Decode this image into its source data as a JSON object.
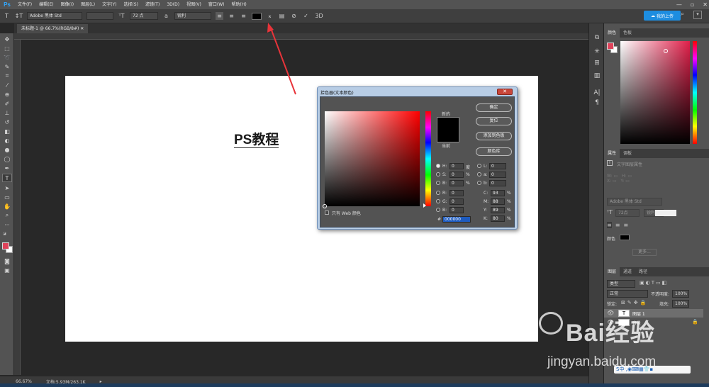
{
  "app": {
    "logo": "Ps"
  },
  "menu": [
    "文件(F)",
    "编辑(E)",
    "图像(I)",
    "图层(L)",
    "文字(Y)",
    "选择(S)",
    "滤镜(T)",
    "3D(D)",
    "视图(V)",
    "窗口(W)",
    "帮助(H)"
  ],
  "window_controls": [
    "—",
    "▫",
    "✕"
  ],
  "options": {
    "font_family": "Adobe 黑体 Std",
    "font_size": "72 点",
    "aa_label": "a",
    "aa_mode": "锐利",
    "text_color": "#000000",
    "cloud_button": "我的上传"
  },
  "document_tab": "未标题-1 @ 66.7%(RGB/8#) ✕",
  "canvas_text": "PS教程",
  "status": {
    "zoom": "66.67%",
    "doc_info": "文档:5.93M/263.1K"
  },
  "right_panels": {
    "color_tabs": [
      "颜色",
      "色板"
    ],
    "props_tabs": [
      "属性",
      "调板"
    ],
    "props_header": "文字图层属性",
    "props_font": "Adobe 黑体 Std",
    "props_size": "72点",
    "props_aa": "锐利",
    "props_color_label": "颜色",
    "props_more": "更多...",
    "layers_tabs": [
      "图层",
      "通道",
      "路径"
    ],
    "layers_kind": "类型",
    "layers_blend": "正常",
    "layers_opacity_label": "不透明度:",
    "layers_opacity": "100%",
    "layers_lock_label": "锁定:",
    "layers_fill_label": "填充:",
    "layers_fill": "100%",
    "layers": [
      {
        "name": "图层 1",
        "thumb": "T"
      },
      {
        "name": "背景",
        "thumb": ""
      }
    ]
  },
  "dialog": {
    "title": "拾色器(文本颜色)",
    "close": "✕",
    "new_label": "新的",
    "current_label": "当前",
    "buttons": [
      "确定",
      "复位",
      "添加到色板",
      "颜色库"
    ],
    "web_only": "只有 Web 颜色",
    "hsb": [
      {
        "k": "H:",
        "v": "0",
        "u": "度"
      },
      {
        "k": "S:",
        "v": "0",
        "u": "%"
      },
      {
        "k": "B:",
        "v": "0",
        "u": "%"
      }
    ],
    "rgb": [
      {
        "k": "R:",
        "v": "0"
      },
      {
        "k": "G:",
        "v": "0"
      },
      {
        "k": "B:",
        "v": "0"
      }
    ],
    "lab": [
      {
        "k": "L:",
        "v": "0"
      },
      {
        "k": "a:",
        "v": "0"
      },
      {
        "k": "b:",
        "v": "0"
      }
    ],
    "cmyk": [
      {
        "k": "C:",
        "v": "93",
        "u": "%"
      },
      {
        "k": "M:",
        "v": "88",
        "u": "%"
      },
      {
        "k": "Y:",
        "v": "89",
        "u": "%"
      },
      {
        "k": "K:",
        "v": "80",
        "u": "%"
      }
    ],
    "hex_label": "#",
    "hex": "000000"
  },
  "colors": {
    "foreground": "#e0425a",
    "background": "#ffffff",
    "accent": "#1d8de0",
    "arrow": "#e8343a"
  },
  "watermark": {
    "brand_text": "Bai经验",
    "url": "jingyan.baidu.com"
  }
}
